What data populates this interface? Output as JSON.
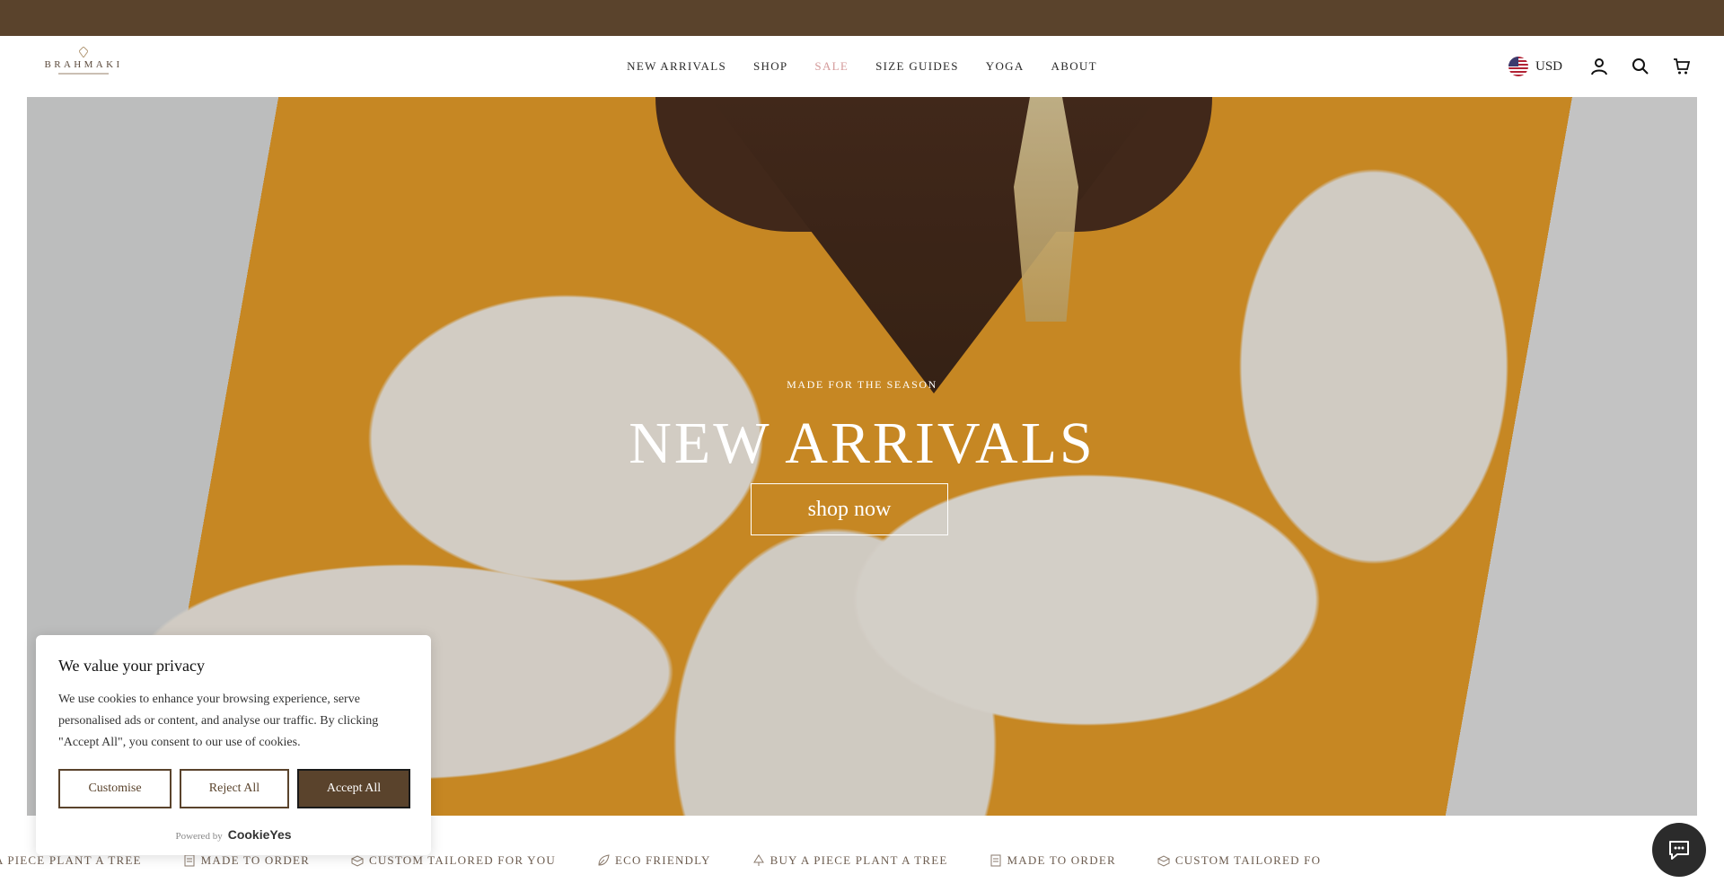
{
  "brand": {
    "name": "BRAHMAKI"
  },
  "nav": {
    "items": [
      {
        "label": "NEW ARRIVALS"
      },
      {
        "label": "SHOP"
      },
      {
        "label": "SALE"
      },
      {
        "label": "SIZE GUIDES"
      },
      {
        "label": "YOGA"
      },
      {
        "label": "ABOUT"
      }
    ]
  },
  "header": {
    "currency": "USD",
    "icons": [
      "account-icon",
      "search-icon",
      "cart-icon"
    ]
  },
  "hero": {
    "kicker": "MADE FOR THE SEASON",
    "title": "NEW ARRIVALS",
    "button": "shop now"
  },
  "marquee": {
    "items": [
      {
        "icon": "tree-icon",
        "label": "A PIECE PLANT A TREE"
      },
      {
        "icon": "order-icon",
        "label": "MADE TO ORDER"
      },
      {
        "icon": "tailor-icon",
        "label": "CUSTOM TAILORED FOR YOU"
      },
      {
        "icon": "leaf-icon",
        "label": "ECO FRIENDLY"
      },
      {
        "icon": "tree-icon",
        "label": "BUY A PIECE PLANT A TREE"
      },
      {
        "icon": "order-icon",
        "label": "MADE TO ORDER"
      },
      {
        "icon": "tailor-icon",
        "label": "CUSTOM TAILORED FO"
      }
    ]
  },
  "cookie": {
    "title": "We value your privacy",
    "text": "We use cookies to enhance your browsing experience, serve personalised ads or content, and analyse our traffic. By clicking \"Accept All\", you consent to our use of cookies.",
    "customise": "Customise",
    "reject": "Reject All",
    "accept": "Accept All",
    "powered_by": "Powered by",
    "powered_brand": "CookieYes"
  },
  "colors": {
    "brand_brown": "#5a432c",
    "sale": "#d49a9a",
    "hero_orange": "#e29a28"
  }
}
